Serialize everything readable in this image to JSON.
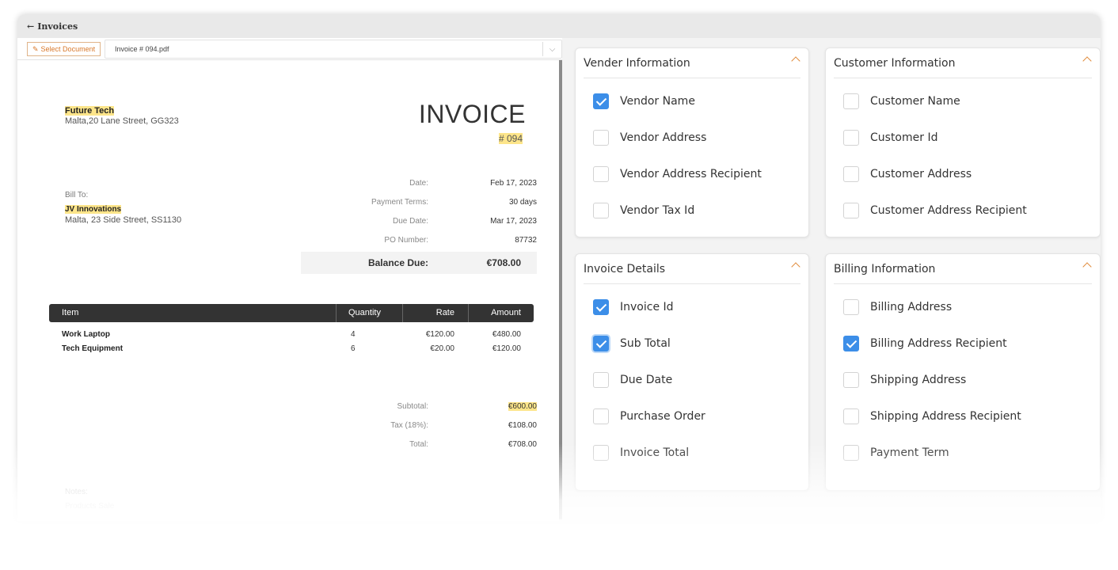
{
  "window": {
    "title": "Invoices",
    "back_glyph": "←"
  },
  "toolbar": {
    "select_document_label": "Select Document",
    "select_document_icon": "edit-icon",
    "file_name": "Invoice # 094.pdf",
    "dropdown_glyph": "⌵"
  },
  "invoice": {
    "seller_name": "Future Tech",
    "seller_address": "Malta,20 Lane Street, GG323",
    "title": "INVOICE",
    "number": "# 094",
    "bill_to_label": "Bill To:",
    "buyer_name": "JV Innovations",
    "buyer_address": "Malta, 23 Side Street, SS1130",
    "meta": [
      {
        "label": "Date:",
        "value": "Feb 17, 2023"
      },
      {
        "label": "Payment Terms:",
        "value": "30 days"
      },
      {
        "label": "Due Date:",
        "value": "Mar 17, 2023"
      },
      {
        "label": "PO Number:",
        "value": "87732"
      }
    ],
    "balance_due": {
      "label": "Balance Due:",
      "value": "€708.00"
    },
    "columns": {
      "item": "Item",
      "quantity": "Quantity",
      "rate": "Rate",
      "amount": "Amount"
    },
    "items": [
      {
        "name": "Work Laptop",
        "quantity": "4",
        "rate": "€120.00",
        "amount": "€480.00"
      },
      {
        "name": "Tech Equipment",
        "quantity": "6",
        "rate": "€20.00",
        "amount": "€120.00"
      }
    ],
    "totals": [
      {
        "label": "Subtotal:",
        "value": "€600.00"
      },
      {
        "label": "Tax (18%):",
        "value": "€108.00"
      },
      {
        "label": "Total:",
        "value": "€708.00"
      }
    ],
    "notes_label": "Notes:",
    "notes_text": "Products Sale"
  },
  "cards": {
    "vendor": {
      "title": "Vender Information",
      "options": [
        {
          "label": "Vendor Name",
          "checked": true
        },
        {
          "label": "Vendor Address",
          "checked": false
        },
        {
          "label": "Vendor Address Recipient",
          "checked": false
        },
        {
          "label": "Vendor Tax Id",
          "checked": false
        }
      ]
    },
    "customer": {
      "title": "Customer Information",
      "options": [
        {
          "label": "Customer Name",
          "checked": false
        },
        {
          "label": "Customer Id",
          "checked": false
        },
        {
          "label": "Customer Address",
          "checked": false
        },
        {
          "label": "Customer Address Recipient",
          "checked": false
        }
      ]
    },
    "invoice_details": {
      "title": "Invoice Details",
      "options": [
        {
          "label": "Invoice Id",
          "checked": true
        },
        {
          "label": "Sub Total",
          "checked": true
        },
        {
          "label": "Due Date",
          "checked": false
        },
        {
          "label": "Purchase Order",
          "checked": false
        },
        {
          "label": "Invoice Total",
          "checked": false
        }
      ]
    },
    "billing": {
      "title": "Billing Information",
      "options": [
        {
          "label": "Billing Address",
          "checked": false
        },
        {
          "label": "Billing Address Recipient",
          "checked": true
        },
        {
          "label": "Shipping Address",
          "checked": false
        },
        {
          "label": "Shipping Address Recipient",
          "checked": false
        },
        {
          "label": "Payment Term",
          "checked": false
        }
      ]
    }
  },
  "colors": {
    "accent": "#e08a3a",
    "checkbox_on": "#3c8ee8",
    "highlight": "#fde58a",
    "table_header": "#333333"
  }
}
